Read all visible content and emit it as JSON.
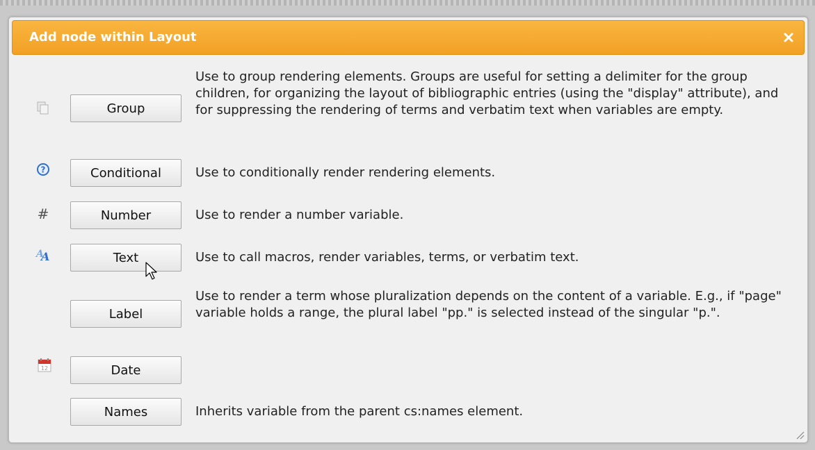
{
  "dialog": {
    "title": "Add node within Layout",
    "close_label": "×"
  },
  "rows": [
    {
      "icon": "group-icon",
      "button_label": "Group",
      "description": "Use to group rendering elements. Groups are useful for setting a delimiter for the group children, for organizing the layout of bibliographic entries (using the \"display\" attribute), and for suppressing the rendering of terms and verbatim text when variables are empty."
    },
    {
      "icon": "question-icon",
      "button_label": "Conditional",
      "description": "Use to conditionally render rendering elements."
    },
    {
      "icon": "hash-icon",
      "icon_glyph": "#",
      "button_label": "Number",
      "description": "Use to render a number variable."
    },
    {
      "icon": "text-icon",
      "button_label": "Text",
      "description": "Use to call macros, render variables, terms, or verbatim text."
    },
    {
      "icon": "",
      "button_label": "Label",
      "description": "Use to render a term whose pluralization depends on the content of a variable. E.g., if \"page\" variable holds a range, the plural label \"pp.\" is selected instead of the singular \"p.\"."
    },
    {
      "icon": "calendar-icon",
      "icon_glyph": "12",
      "button_label": "Date",
      "description": ""
    },
    {
      "icon": "",
      "button_label": "Names",
      "description": "Inherits variable from the parent cs:names element."
    }
  ],
  "colors": {
    "titlebar": "#f4a52c",
    "dialog_bg": "#f0f0f0",
    "text": "#222222",
    "help_icon": "#2f6fcf"
  }
}
